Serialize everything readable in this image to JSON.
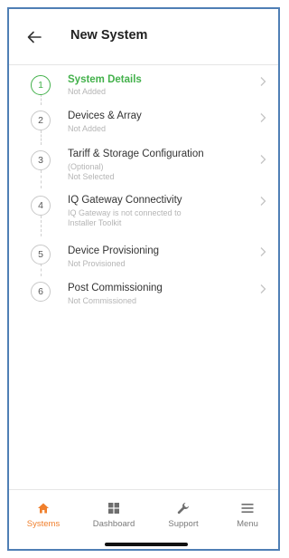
{
  "header": {
    "title": "New System",
    "back_icon": "arrow-left-icon"
  },
  "steps": [
    {
      "number": "1",
      "title": "System Details",
      "status": "Not Added",
      "active": true
    },
    {
      "number": "2",
      "title": "Devices & Array",
      "status": "Not Added",
      "active": false
    },
    {
      "number": "3",
      "title": "Tariff & Storage Configuration",
      "optional": "(Optional)",
      "status": "Not Selected",
      "active": false
    },
    {
      "number": "4",
      "title": "IQ Gateway Connectivity",
      "status_line1": "IQ Gateway is not connected to",
      "status_line2": "Installer Toolkit",
      "active": false
    },
    {
      "number": "5",
      "title": "Device Provisioning",
      "status": "Not Provisioned",
      "active": false
    },
    {
      "number": "6",
      "title": "Post Commissioning",
      "status": "Not Commissioned",
      "active": false
    }
  ],
  "tabbar": {
    "items": [
      {
        "label": "Systems",
        "icon": "house-icon",
        "active": true
      },
      {
        "label": "Dashboard",
        "icon": "grid-icon",
        "active": false
      },
      {
        "label": "Support",
        "icon": "wrench-icon",
        "active": false
      },
      {
        "label": "Menu",
        "icon": "hamburger-icon",
        "active": false
      }
    ]
  },
  "colors": {
    "active_green": "#43b14b",
    "active_orange": "#f07f2c",
    "frame_border": "#4f7fb5"
  }
}
